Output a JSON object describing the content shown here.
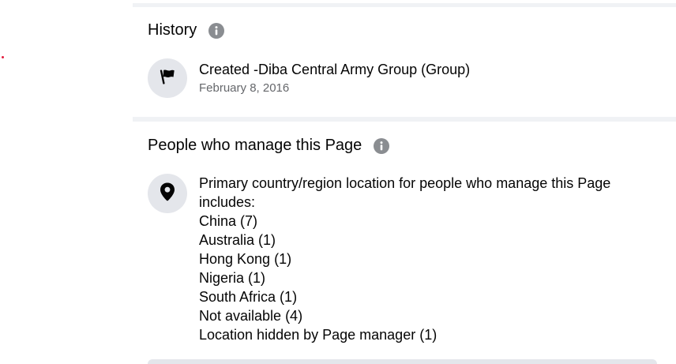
{
  "history": {
    "title": "History",
    "info_icon": "info-icon",
    "entry": {
      "icon": "flag-icon",
      "title": "Created -Diba Central Army Group (Group)",
      "date": "February 8, 2016"
    }
  },
  "managers": {
    "title": "People who manage this Page",
    "info_icon": "info-icon",
    "icon": "location-pin-icon",
    "intro": "Primary country/region location for people who manage this Page includes:",
    "locations": [
      "China (7)",
      "Australia (1)",
      "Hong Kong (1)",
      "Nigeria (1)",
      "South Africa (1)",
      "Not available (4)",
      "Location hidden by Page manager (1)"
    ]
  },
  "colors": {
    "text_primary": "#050505",
    "text_secondary": "#65676b",
    "icon_background": "#e4e6eb",
    "info_icon": "#8a8d91",
    "divider": "#f0f2f5",
    "accent_dot": "#e41e3f"
  }
}
